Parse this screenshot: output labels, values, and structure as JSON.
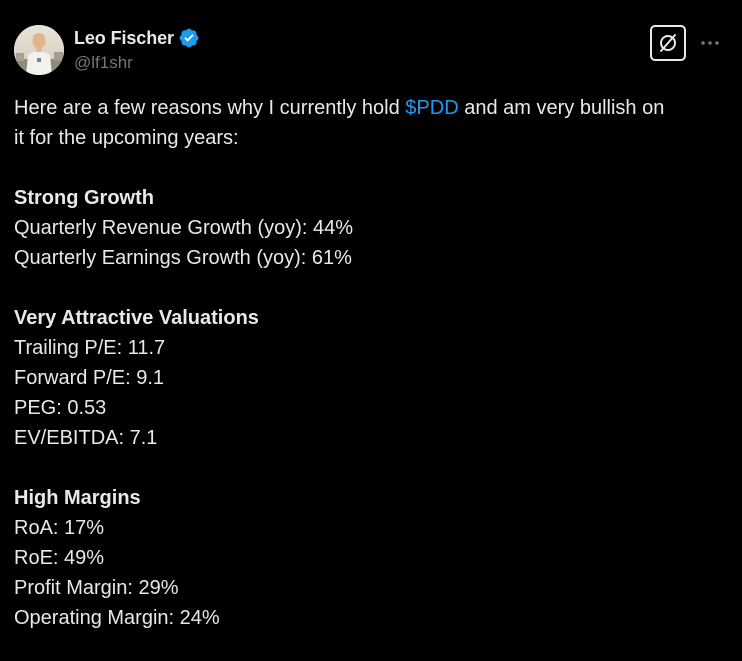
{
  "author": {
    "display_name": "Leo Fischer",
    "handle": "@lf1shr",
    "verified": true,
    "avatar_icon": "avatar-photo"
  },
  "colors": {
    "background": "#000000",
    "text": "#e7e9ea",
    "muted": "#71767b",
    "link": "#1d9bf0",
    "verified_badge": "#1d9bf0"
  },
  "icons": {
    "grok": "grok-icon",
    "more": "more-horizontal-icon",
    "verified": "verified-badge-icon"
  },
  "tweet": {
    "intro_part1": "Here are a few reasons why I currently hold ",
    "cashtag": "$PDD",
    "intro_part2": " and am very bullish on",
    "intro_line2": "it for the upcoming years:",
    "sections": [
      {
        "heading": "Strong Growth",
        "items": [
          "Quarterly Revenue Growth (yoy): 44%",
          "Quarterly Earnings Growth (yoy): 61%"
        ]
      },
      {
        "heading": "Very Attractive Valuations",
        "items": [
          "Trailing P/E: 11.7",
          "Forward P/E: 9.1",
          "PEG: 0.53",
          "EV/EBITDA: 7.1"
        ]
      },
      {
        "heading": "High Margins",
        "items": [
          "RoA: 17%",
          "RoE: 49%",
          "Profit Margin: 29%",
          "Operating Margin: 24%"
        ]
      }
    ]
  }
}
